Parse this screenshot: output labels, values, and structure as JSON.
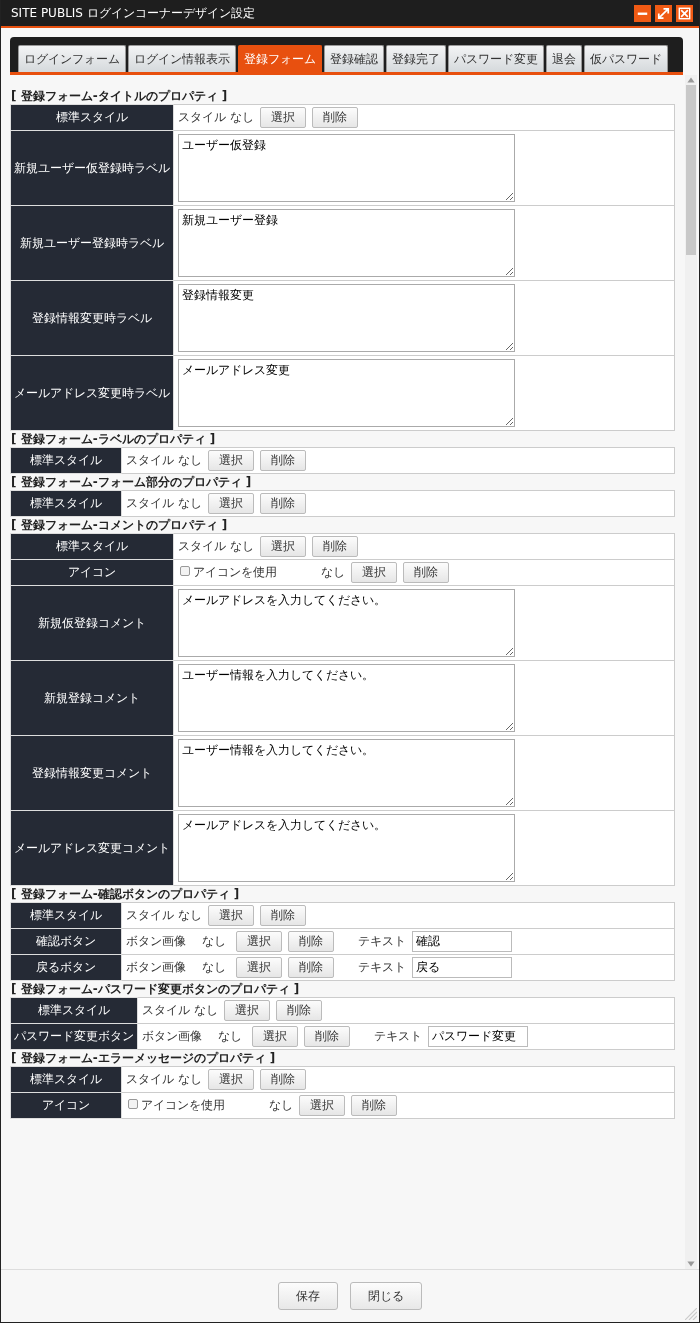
{
  "window": {
    "title": "SITE PUBLIS ログインコーナーデザイン設定"
  },
  "tabs": [
    {
      "label": "ログインフォーム",
      "selected": false
    },
    {
      "label": "ログイン情報表示",
      "selected": false
    },
    {
      "label": "登録フォーム",
      "selected": true
    },
    {
      "label": "登録確認",
      "selected": false
    },
    {
      "label": "登録完了",
      "selected": false
    },
    {
      "label": "パスワード変更",
      "selected": false
    },
    {
      "label": "退会",
      "selected": false
    },
    {
      "label": "仮パスワード",
      "selected": false
    }
  ],
  "sections": [
    {
      "title": "[ 登録フォーム-タイトルのプロパティ ]",
      "rows": [
        {
          "kind": "style",
          "label": "標準スタイル",
          "status": "スタイル なし",
          "buttons": [
            "選択",
            "削除"
          ]
        },
        {
          "kind": "textarea",
          "label": "新規ユーザー仮登録時ラベル",
          "value": "ユーザー仮登録"
        },
        {
          "kind": "textarea",
          "label": "新規ユーザー登録時ラベル",
          "value": "新規ユーザー登録"
        },
        {
          "kind": "textarea",
          "label": "登録情報変更時ラベル",
          "value": "登録情報変更"
        },
        {
          "kind": "textarea",
          "label": "メールアドレス変更時ラベル",
          "value": "メールアドレス変更"
        }
      ]
    },
    {
      "title": "[ 登録フォーム-ラベルのプロパティ ]",
      "rows": [
        {
          "kind": "style",
          "label": "標準スタイル",
          "status": "スタイル なし",
          "buttons": [
            "選択",
            "削除"
          ]
        }
      ]
    },
    {
      "title": "[ 登録フォーム-フォーム部分のプロパティ ]",
      "rows": [
        {
          "kind": "style",
          "label": "標準スタイル",
          "status": "スタイル なし",
          "buttons": [
            "選択",
            "削除"
          ]
        }
      ]
    },
    {
      "title": "[ 登録フォーム-コメントのプロパティ ]",
      "rows": [
        {
          "kind": "style",
          "label": "標準スタイル",
          "status": "スタイル なし",
          "buttons": [
            "選択",
            "削除"
          ]
        },
        {
          "kind": "icon",
          "label": "アイコン",
          "checkbox": {
            "label": "アイコンを使用",
            "checked": false
          },
          "status": "なし",
          "buttons": [
            "選択",
            "削除"
          ]
        },
        {
          "kind": "textarea",
          "label": "新規仮登録コメント",
          "value": "メールアドレスを入力してください。"
        },
        {
          "kind": "textarea",
          "label": "新規登録コメント",
          "value": "ユーザー情報を入力してください。"
        },
        {
          "kind": "textarea",
          "label": "登録情報変更コメント",
          "value": "ユーザー情報を入力してください。"
        },
        {
          "kind": "textarea",
          "label": "メールアドレス変更コメント",
          "value": "メールアドレスを入力してください。"
        }
      ]
    },
    {
      "title": "[ 登録フォーム-確認ボタンのプロパティ ]",
      "rows": [
        {
          "kind": "style",
          "label": "標準スタイル",
          "status": "スタイル なし",
          "buttons": [
            "選択",
            "削除"
          ]
        },
        {
          "kind": "button",
          "label": "確認ボタン",
          "image_label": "ボタン画像",
          "status": "なし",
          "buttons": [
            "選択",
            "削除"
          ],
          "text_label": "テキスト",
          "text_value": "確認"
        },
        {
          "kind": "button",
          "label": "戻るボタン",
          "image_label": "ボタン画像",
          "status": "なし",
          "buttons": [
            "選択",
            "削除"
          ],
          "text_label": "テキスト",
          "text_value": "戻る"
        }
      ]
    },
    {
      "title": "[ 登録フォーム-パスワード変更ボタンのプロパティ ]",
      "rows": [
        {
          "kind": "style",
          "label": "標準スタイル",
          "status": "スタイル なし",
          "buttons": [
            "選択",
            "削除"
          ]
        },
        {
          "kind": "button",
          "label": "パスワード変更ボタン",
          "image_label": "ボタン画像",
          "status": "なし",
          "buttons": [
            "選択",
            "削除"
          ],
          "text_label": "テキスト",
          "text_value": "パスワード変更"
        }
      ]
    },
    {
      "title": "[ 登録フォーム-エラーメッセージのプロパティ ]",
      "rows": [
        {
          "kind": "style",
          "label": "標準スタイル",
          "status": "スタイル なし",
          "buttons": [
            "選択",
            "削除"
          ]
        },
        {
          "kind": "icon",
          "label": "アイコン",
          "checkbox": {
            "label": "アイコンを使用",
            "checked": false
          },
          "status": "なし",
          "buttons": [
            "選択",
            "削除"
          ]
        }
      ]
    }
  ],
  "footer_buttons": [
    "保存",
    "閉じる"
  ]
}
